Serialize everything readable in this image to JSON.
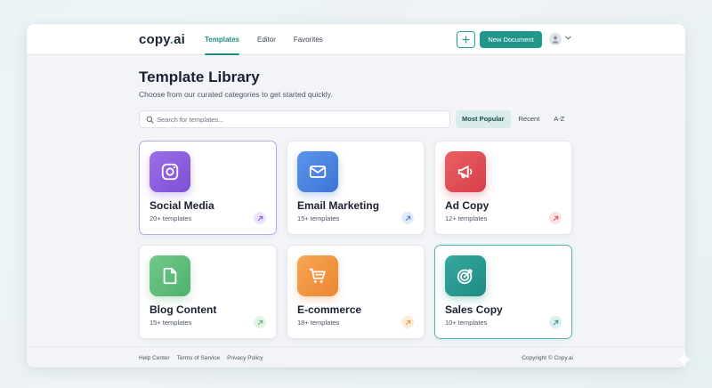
{
  "app": {
    "logo_main": "copy",
    "logo_dot": ".",
    "logo_suffix": "ai"
  },
  "nav": {
    "items": [
      {
        "label": "Templates",
        "active": true
      },
      {
        "label": "Editor",
        "active": false
      },
      {
        "label": "Favorites",
        "active": false
      }
    ]
  },
  "toolbar": {
    "add_icon": "plus-icon",
    "new_document_label": "New Document",
    "avatar_icon": "user-icon"
  },
  "header": {
    "title": "Template Library",
    "subtitle": "Choose from our curated categories to get started quickly."
  },
  "search": {
    "placeholder": "Search for templates...",
    "value": ""
  },
  "sort": {
    "options": [
      {
        "label": "Most Popular",
        "active": true
      },
      {
        "label": "Recent",
        "active": false
      },
      {
        "label": "A-Z",
        "active": false
      }
    ]
  },
  "cards": [
    {
      "title": "Social Media",
      "count": "20+ templates",
      "icon": "instagram-icon",
      "color": "#8e63d9",
      "badge_color": "#ece4fb"
    },
    {
      "title": "Email Marketing",
      "count": "15+ templates",
      "icon": "mail-icon",
      "color": "#4a86e0",
      "badge_color": "#e1ebfb"
    },
    {
      "title": "Ad Copy",
      "count": "12+ templates",
      "icon": "megaphone-icon",
      "color": "#e25158",
      "badge_color": "#fbe3e4"
    },
    {
      "title": "Blog Content",
      "count": "15+ templates",
      "icon": "document-icon",
      "color": "#5fbe7c",
      "badge_color": "#e2f5e7"
    },
    {
      "title": "E-commerce",
      "count": "18+ templates",
      "icon": "shopping-cart-icon",
      "color": "#f29640",
      "badge_color": "#fdecd9"
    },
    {
      "title": "Sales Copy",
      "count": "10+ templates",
      "icon": "target-icon",
      "color": "#2c9d94",
      "badge_color": "#dcefee"
    }
  ],
  "footer": {
    "links": [
      "Help Center",
      "Terms of Service",
      "Privacy Policy"
    ],
    "copyright": "Copyright © Copy.ai"
  }
}
